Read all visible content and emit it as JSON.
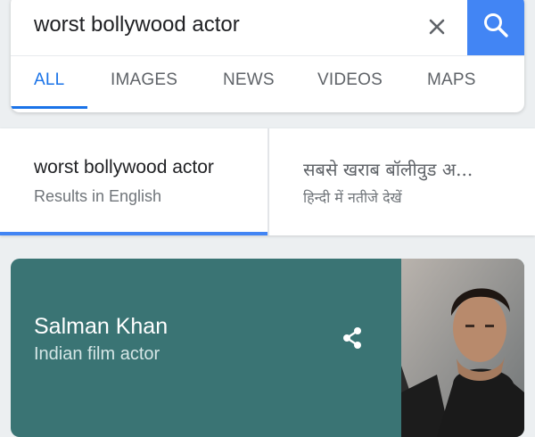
{
  "search": {
    "query": "worst bollywood actor",
    "clear_icon": "close-icon",
    "search_icon": "search-icon",
    "accent": "#4285f4"
  },
  "tabs": [
    {
      "label": "ALL",
      "active": true
    },
    {
      "label": "IMAGES",
      "active": false
    },
    {
      "label": "NEWS",
      "active": false
    },
    {
      "label": "VIDEOS",
      "active": false
    },
    {
      "label": "MAPS",
      "active": false
    }
  ],
  "language_options": [
    {
      "title": "worst bollywood actor",
      "subtitle": "Results in English",
      "selected": true
    },
    {
      "title": "सबसे खराब बॉलीवुड अ...",
      "subtitle": "हिन्दी में नतीजे देखें",
      "selected": false
    }
  ],
  "knowledge_panel": {
    "title": "Salman Khan",
    "subtitle": "Indian film actor",
    "share_icon": "share-icon",
    "background_color": "#3a7474"
  }
}
